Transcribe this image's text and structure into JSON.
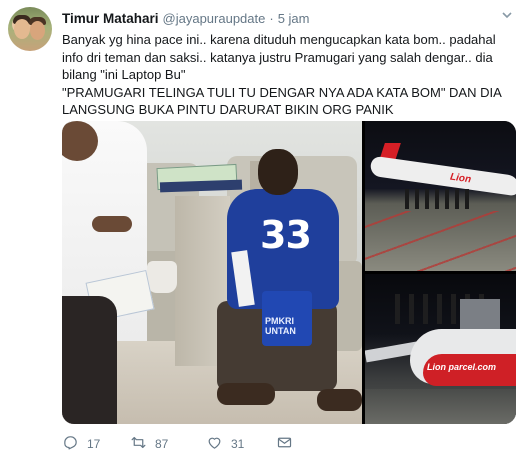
{
  "tweet": {
    "author_name": "Timur Matahari",
    "handle": "@jayapuraupdate",
    "separator": "·",
    "time": "5 jam",
    "text_lines": [
      "Banyak yg hina pace ini.. karena dituduh mengucapkan kata bom.. padahal info dri teman dan saksi.. katanya justru Pramugari yang salah dengar.. dia bilang \"ini Laptop Bu\"",
      "\"PRAMUGARI TELINGA TULI TU DENGAR NYA ADA KATA BOM\" DAN DIA LANGSUNG BUKA PINTU DARURAT BIKIN ORG PANIK"
    ],
    "media": {
      "photo_main_shirt_number": "33",
      "photo_main_tote_text": "PMKRI\nUNTAN",
      "photo_top_logo": "Lion",
      "photo_bottom_logo": "Lion parcel.com"
    },
    "actions": {
      "reply_count": "17",
      "retweet_count": "87",
      "like_count": "31"
    }
  },
  "icons": {
    "reply": "reply-icon",
    "retweet": "retweet-icon",
    "like": "heart-icon",
    "dm": "envelope-icon",
    "more": "chevron-down-icon"
  },
  "colors": {
    "text": "#14171a",
    "muted": "#657786",
    "brand_red": "#d61f26",
    "shirt_blue": "#1f3f9c"
  }
}
